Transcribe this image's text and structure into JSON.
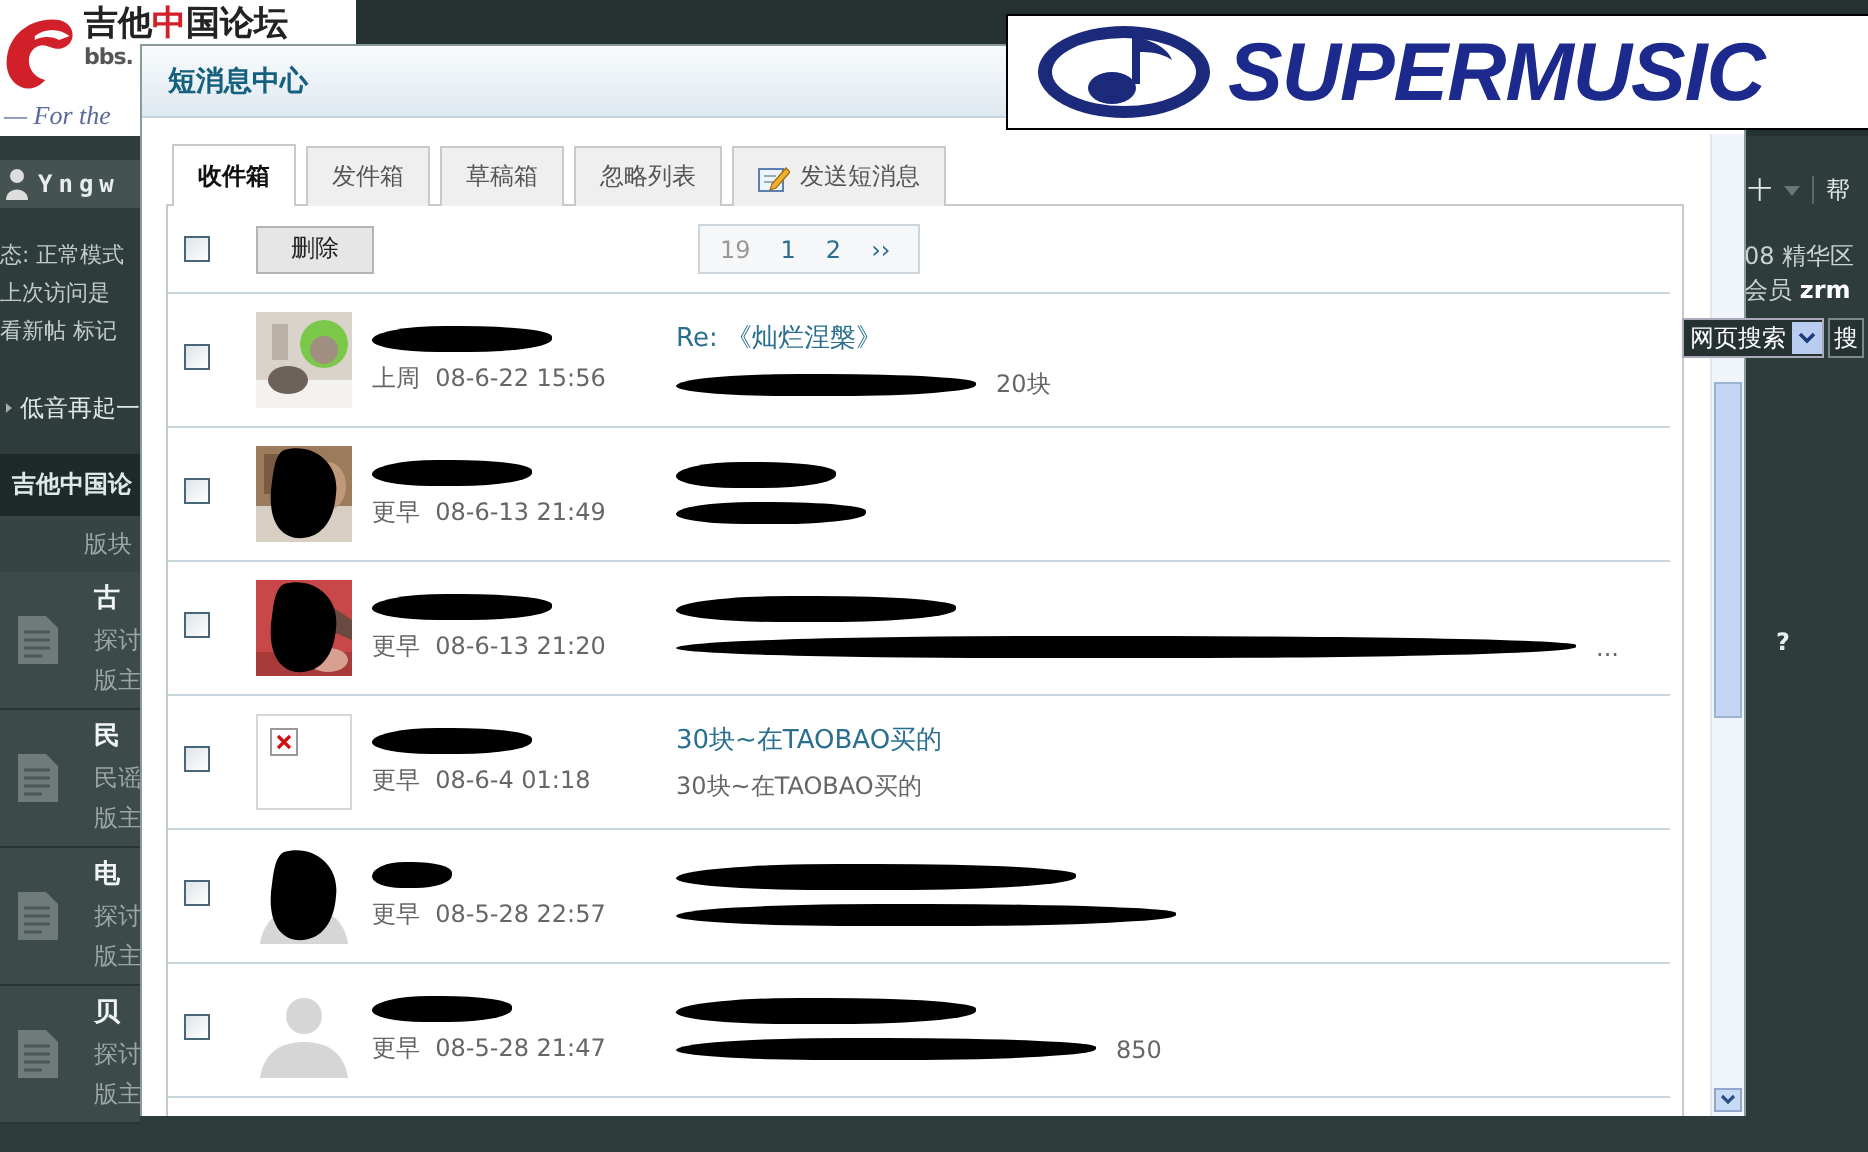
{
  "page": {
    "logo": {
      "parts": [
        {
          "text": "吉他",
          "highlight": false
        },
        {
          "text": "中",
          "highlight": true
        },
        {
          "text": "国论坛",
          "highlight": false
        }
      ],
      "domain": "bbs.",
      "slogan": "— For the"
    },
    "user": "Yngw",
    "status_lines": [
      "态: 正常模式",
      "上次访问是",
      "看新帖 标记"
    ],
    "thread_link": "低音再起一",
    "section_title": "吉他中国论",
    "column_header": "版块",
    "forums": [
      {
        "title": "古",
        "desc": "探讨",
        "mod": "版主"
      },
      {
        "title": "民",
        "desc": "民谣",
        "mod": "版主"
      },
      {
        "title": "电",
        "desc": "探讨",
        "mod": "版主"
      },
      {
        "title": "贝",
        "desc": "探讨",
        "mod": "版主"
      }
    ],
    "toolbar": {
      "item": "十",
      "help": "帮"
    },
    "stats": "08 精华区",
    "members": {
      "label": "会员",
      "name": "zrm"
    },
    "search": {
      "value": "网页搜索",
      "button": "搜"
    },
    "help_mark": "?"
  },
  "banner": {
    "text": "SUPERMUSIC"
  },
  "dialog": {
    "title": "短消息中心",
    "tabs": [
      {
        "label": "收件箱",
        "selected": true
      },
      {
        "label": "发件箱",
        "selected": false
      },
      {
        "label": "草稿箱",
        "selected": false
      },
      {
        "label": "忽略列表",
        "selected": false
      },
      {
        "label": "发送短消息",
        "selected": false,
        "kind": "compose"
      }
    ],
    "select_all": {
      "checked": false
    },
    "delete_button": "删除",
    "pagination": {
      "total": "19",
      "pages": [
        "1",
        "2"
      ],
      "next": "››"
    },
    "messages": [
      {
        "checked": false,
        "kind": "picture",
        "avatar_redacted": false,
        "group": "上周",
        "time": "08-6-22 15:56",
        "subject_redacted": false,
        "subject": "Re: 《灿烂涅槃》",
        "summary_redacted": true,
        "summary": "20块"
      },
      {
        "checked": false,
        "kind": "picture",
        "avatar_redacted": true,
        "group": "更早",
        "time": "08-6-13 21:49",
        "subject_redacted": true,
        "summary_redacted": true
      },
      {
        "checked": false,
        "kind": "picture",
        "avatar_redacted": true,
        "group": "更早",
        "time": "08-6-13 21:20",
        "subject_redacted": true,
        "summary_redacted": true,
        "summary": "..."
      },
      {
        "checked": false,
        "kind": "broken",
        "avatar_redacted": false,
        "group": "更早",
        "time": "08-6-4 01:18",
        "subject_redacted": false,
        "subject": "30块~在TAOBAO买的",
        "summary_redacted": false,
        "summary": "30块~在TAOBAO买的"
      },
      {
        "checked": false,
        "kind": "default",
        "avatar_redacted": true,
        "group": "更早",
        "time": "08-5-28 22:57",
        "subject_redacted": true,
        "summary_redacted": true
      },
      {
        "checked": false,
        "kind": "default",
        "avatar_redacted": false,
        "group": "更早",
        "time": "08-5-28 21:47",
        "subject_redacted": true,
        "summary_redacted": true,
        "summary": "850"
      }
    ]
  }
}
